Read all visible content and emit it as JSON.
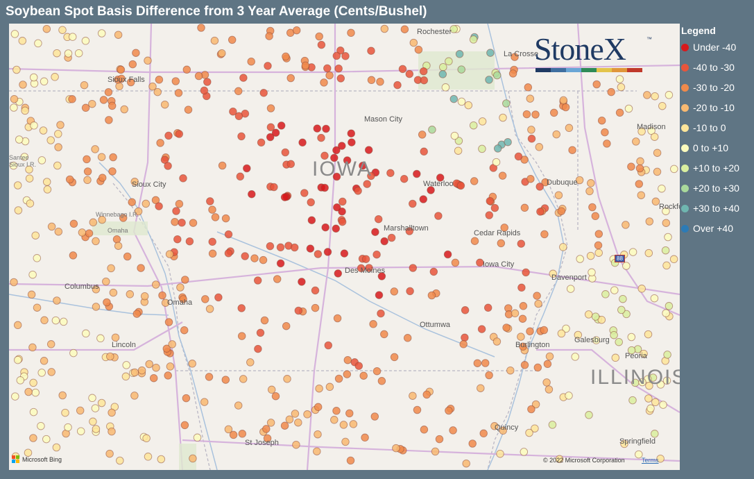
{
  "title": "Soybean Spot Basis Difference from 3 Year Average (Cents/Bushel)",
  "legend": {
    "title": "Legend",
    "items": [
      {
        "label": "Under -40",
        "color": "#d7191c"
      },
      {
        "label": "-40 to -30",
        "color": "#e8553b"
      },
      {
        "label": "-30 to -20",
        "color": "#f08a4b"
      },
      {
        "label": "-20 to -10",
        "color": "#f8b971"
      },
      {
        "label": "-10 to 0",
        "color": "#fde59a"
      },
      {
        "label": "0 to +10",
        "color": "#fbfbbd"
      },
      {
        "label": "+10 to +20",
        "color": "#d9ef9f"
      },
      {
        "label": "+20 to +30",
        "color": "#a9d99b"
      },
      {
        "label": "+30 to +40",
        "color": "#6fb6b0"
      },
      {
        "label": "Over +40",
        "color": "#2c7bb6"
      }
    ]
  },
  "logo": {
    "text": "StoneX",
    "tm": "™",
    "colors": [
      "#1f3a63",
      "#3f6fa0",
      "#6aa6d6",
      "#2e8b57",
      "#e3c44b",
      "#e0963a",
      "#c0392b"
    ]
  },
  "map": {
    "labels": {
      "rochester": "Rochester",
      "la_crosse": "La Crosse",
      "sioux_falls": "Sioux Falls",
      "mason_city": "Mason City",
      "madison": "Madison",
      "santee": "Santee Sioux I.R.",
      "sioux_city": "Sioux City",
      "iowa": "IOWA",
      "waterloo": "Waterloo",
      "dubuque": "Dubuque",
      "winnebago": "Winnebago I.R.",
      "omaha_ir": "Omaha",
      "rockford": "Rockford",
      "marshalltown": "Marshalltown",
      "cedar_rapids": "Cedar Rapids",
      "iowa_city": "Iowa City",
      "columbus": "Columbus",
      "des_moines": "Des Moines",
      "davenport": "Davenport",
      "omaha": "Omaha",
      "ottumwa": "Ottumwa",
      "lincoln": "Lincoln",
      "galesburg": "Galesburg",
      "burlington": "Burlington",
      "peoria": "Peoria",
      "illinois": "ILLINOIS",
      "quincy": "Quincy",
      "st_joseph": "St Joseph",
      "springfield": "Springfield",
      "i88": "88"
    },
    "attribution": "Microsoft Bing",
    "copyright": "© 2022 Microsoft Corporation",
    "terms": "Terms"
  }
}
